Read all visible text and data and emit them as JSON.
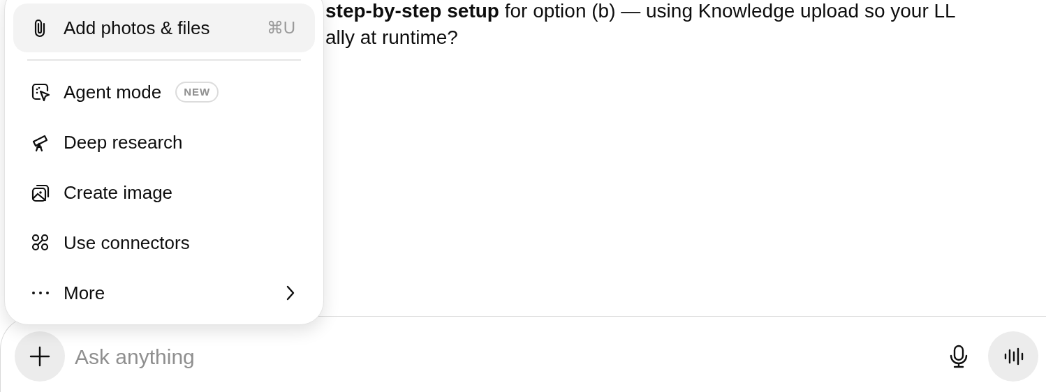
{
  "message": {
    "lines": [
      "**step-by-step setup** for option (b) — using Knowledge upload so your LL",
      "ally at runtime?"
    ]
  },
  "menu": {
    "items": [
      {
        "kind": "attach",
        "label": "Add photos & files",
        "shortcut": "⌘U",
        "selected": true
      },
      {
        "kind": "divider"
      },
      {
        "kind": "agent",
        "label": "Agent mode",
        "badge": "NEW",
        "selected": false
      },
      {
        "kind": "research",
        "label": "Deep research",
        "selected": false
      },
      {
        "kind": "image",
        "label": "Create image",
        "selected": false
      },
      {
        "kind": "connectors",
        "label": "Use connectors",
        "selected": false
      },
      {
        "kind": "more",
        "label": "More",
        "submenu": true,
        "selected": false
      }
    ]
  },
  "composer": {
    "placeholder": "Ask anything"
  }
}
